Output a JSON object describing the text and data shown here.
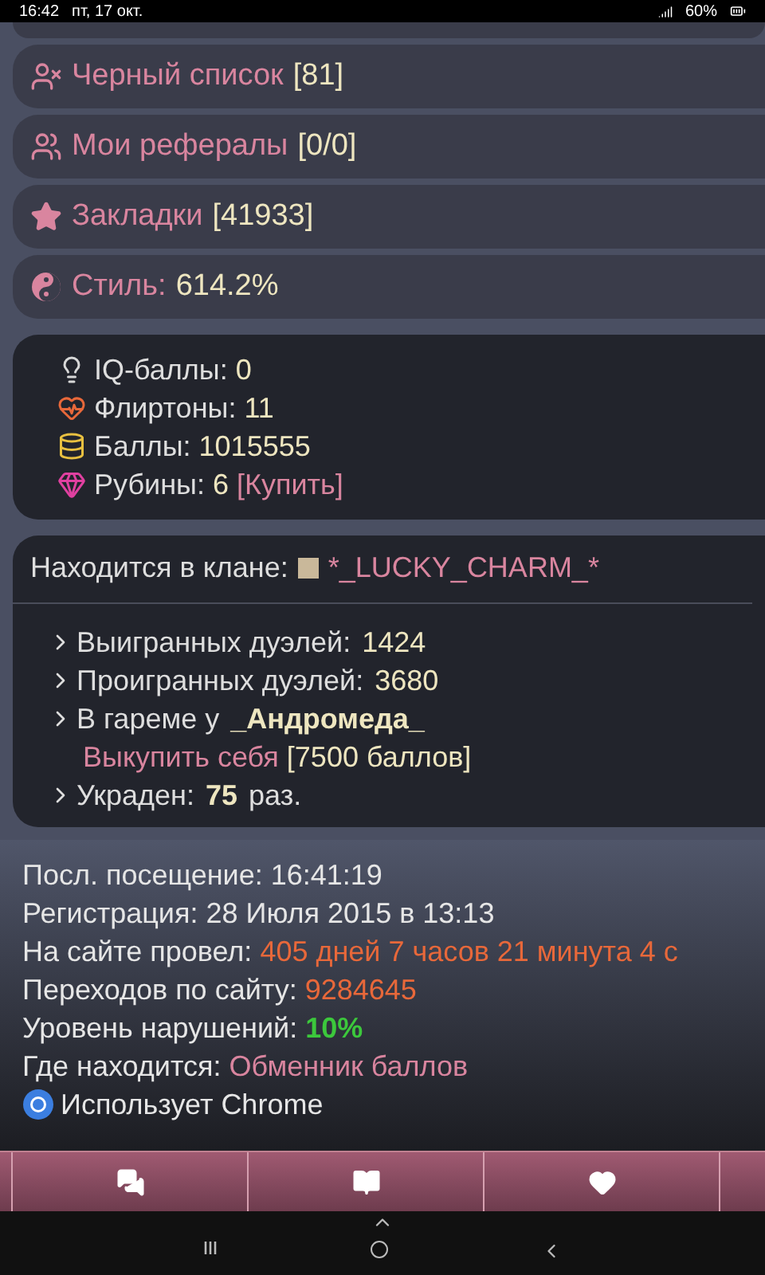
{
  "status_bar": {
    "time": "16:42",
    "date": "пт, 17 окт.",
    "battery": "60%"
  },
  "menu_items": [
    {
      "kind": "user-x",
      "label": "Черный список",
      "count": "[81]"
    },
    {
      "kind": "referrals",
      "label": "Мои рефералы",
      "count": "[0/0]"
    },
    {
      "kind": "star",
      "label": "Закладки",
      "count": "[41933]"
    },
    {
      "kind": "yin-yang",
      "label": "Стиль:",
      "count": "614.2%"
    }
  ],
  "stats": [
    {
      "kind": "bulb",
      "label": "IQ-баллы:",
      "value": "0"
    },
    {
      "kind": "heart-pulse",
      "label": "Флиртоны:",
      "value": "11"
    },
    {
      "kind": "coins",
      "label": "Баллы:",
      "value": "1015555"
    },
    {
      "kind": "gem",
      "label": "Рубины:",
      "value": "6",
      "link": "[Купить]"
    }
  ],
  "clan": {
    "label": "Находится в клане:",
    "name": "*_LUCKY_CHARM_*"
  },
  "duels": [
    {
      "kind": "stat",
      "label": "Выигранных дуэлей:",
      "value": "1424"
    },
    {
      "kind": "stat",
      "label": "Проигранных дуэлей:",
      "value": "3680"
    },
    {
      "kind": "harem",
      "label": "В гареме у",
      "value": "_Андромеда_",
      "link": "Выкупить себя",
      "note": "[7500 баллов]"
    },
    {
      "kind": "stolen",
      "label": "Украден:",
      "value": "75",
      "suffix": "раз."
    }
  ],
  "info": [
    {
      "kind": "plain",
      "label": "Посл. посещение:",
      "value": "16:41:19"
    },
    {
      "kind": "plain",
      "label": "Регистрация:",
      "value": "28 Июля 2015 в 13:13"
    },
    {
      "kind": "orange",
      "label": "На сайте провел:",
      "value": "405 дней 7 часов 21 минута 4 с"
    },
    {
      "kind": "orange",
      "label": "Переходов по сайту:",
      "value": "9284645"
    },
    {
      "kind": "green",
      "label": "Уровень нарушений:",
      "value": "10%"
    },
    {
      "kind": "pink",
      "label": "Где находится:",
      "value": "Обменник баллов"
    },
    {
      "kind": "browser",
      "label": "Использует Chrome"
    }
  ]
}
